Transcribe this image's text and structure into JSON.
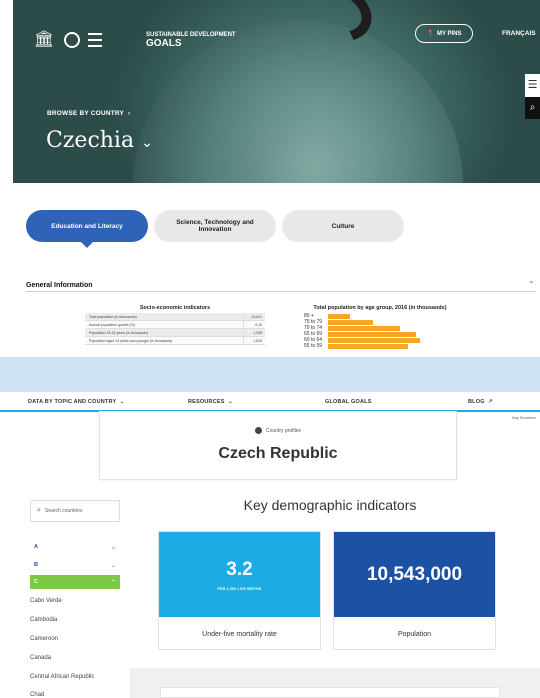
{
  "uis_header": {
    "brand_sdg_top": "Sustainable Development",
    "brand_sdg_bottom": "Goals",
    "pins_label": "MY PINS",
    "language": "FRANÇAIS"
  },
  "uis_hero": {
    "browse_label": "BROWSE BY COUNTRY",
    "country": "Czechia"
  },
  "tabs": [
    {
      "label": "Education and Literacy",
      "active": true
    },
    {
      "label": "Science, Technology and Innovation",
      "active": false
    },
    {
      "label": "Culture",
      "active": false
    }
  ],
  "general_info": {
    "heading": "General Information",
    "socio_title": "Socio-economic indicators",
    "socio_rows": [
      {
        "label": "Total population (in thousands)",
        "value": "10,611"
      },
      {
        "label": "Annual population growth (%)",
        "value": "0.10"
      },
      {
        "label": "Population 15-24 years (in thousands)",
        "value": "1,035"
      },
      {
        "label": "Population aged 14 years and younger (in thousands)",
        "value": "1,619"
      }
    ],
    "pop_title": "Total population by age group, 2016 (in thousands)",
    "pop_rows": [
      {
        "label": "80 +",
        "value": 0.22
      },
      {
        "label": "75 to 79",
        "value": 0.45
      },
      {
        "label": "70 to 74",
        "value": 0.72
      },
      {
        "label": "65 to 69",
        "value": 0.88
      },
      {
        "label": "60 to 64",
        "value": 0.92
      },
      {
        "label": "55 to 59",
        "value": 0.8
      }
    ]
  },
  "unicef_nav": {
    "items": [
      "DATA BY TOPIC AND COUNTRY",
      "RESOURCES",
      "GLOBAL GOALS",
      "BLOG"
    ],
    "map_disclaimer": "Map Disclaimer"
  },
  "profile": {
    "subtitle": "Country profiles",
    "title": "Czech Republic"
  },
  "sidebar": {
    "search_placeholder": "Search countries",
    "letters": [
      {
        "label": "A",
        "active": false
      },
      {
        "label": "B",
        "active": false
      },
      {
        "label": "C",
        "active": true
      }
    ],
    "countries": [
      "Cabo Verde",
      "Cambodia",
      "Cameroon",
      "Canada",
      "Central African Republic",
      "Chad"
    ]
  },
  "indicators": {
    "title": "Key demographic indicators",
    "cards": [
      {
        "value": "3.2",
        "unit": "PER 1,000 LIVE BIRTHS",
        "label": "Under-five mortality rate",
        "color": "#1cabe2"
      },
      {
        "value": "10,543,000",
        "unit": "",
        "label": "Population",
        "color": "#1d51a4"
      }
    ]
  }
}
